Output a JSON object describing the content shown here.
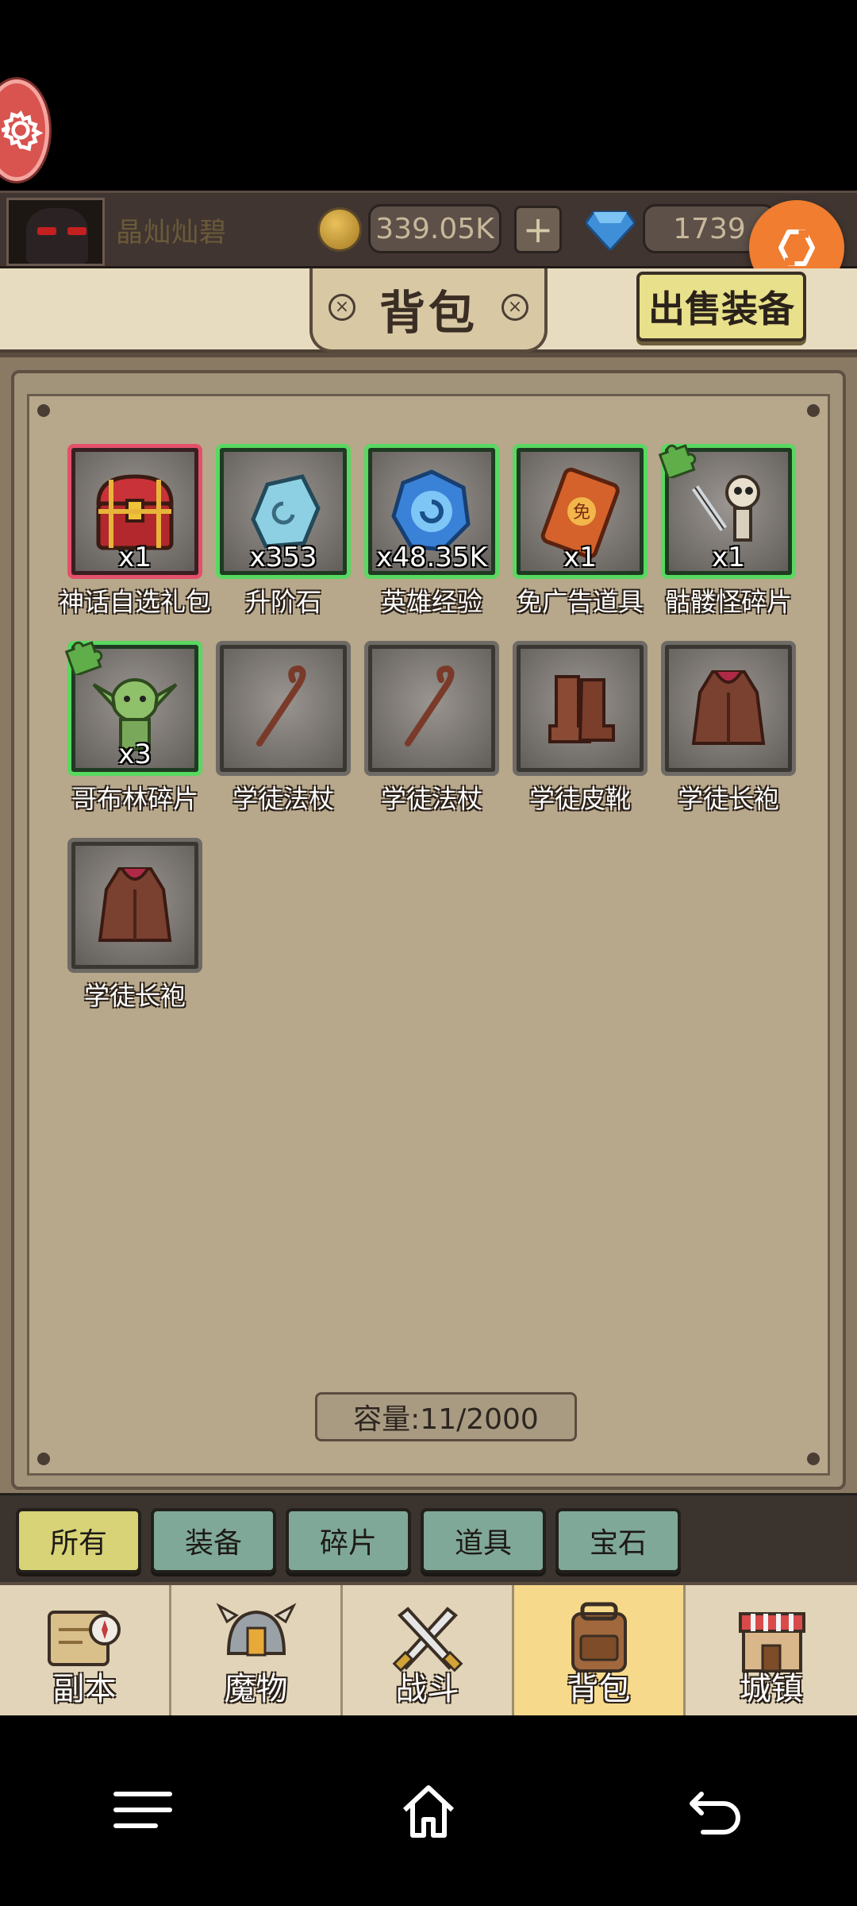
{
  "top_bar": {
    "player_name": "晶灿灿碧",
    "coins": "339.05K",
    "plus_label": "+",
    "gems": "1739"
  },
  "header": {
    "title": "背包",
    "sell_button": "出售装备",
    "left_bolt": "×",
    "right_bolt": "×"
  },
  "items": [
    {
      "label": "神话自选礼包",
      "qty": "x1",
      "rarity": "red",
      "icon": "treasure-chest-icon"
    },
    {
      "label": "升阶石",
      "qty": "x353",
      "rarity": "green",
      "icon": "upgrade-stone-icon"
    },
    {
      "label": "英雄经验",
      "qty": "x48.35K",
      "rarity": "green",
      "icon": "hero-exp-orb-icon"
    },
    {
      "label": "免广告道具",
      "qty": "x1",
      "rarity": "green",
      "icon": "ad-free-card-icon"
    },
    {
      "label": "骷髅怪碎片",
      "qty": "x1",
      "rarity": "green",
      "icon": "skeleton-shard-icon"
    },
    {
      "label": "哥布林碎片",
      "qty": "x3",
      "rarity": "green",
      "icon": "goblin-shard-icon"
    },
    {
      "label": "学徒法杖",
      "qty": "",
      "rarity": "gray",
      "icon": "staff-icon"
    },
    {
      "label": "学徒法杖",
      "qty": "",
      "rarity": "gray",
      "icon": "staff-icon"
    },
    {
      "label": "学徒皮靴",
      "qty": "",
      "rarity": "gray",
      "icon": "boots-icon"
    },
    {
      "label": "学徒长袍",
      "qty": "",
      "rarity": "gray",
      "icon": "robe-icon"
    },
    {
      "label": "学徒长袍",
      "qty": "",
      "rarity": "gray",
      "icon": "robe-icon"
    }
  ],
  "capacity": "容量:11/2000",
  "filter_tabs": [
    "所有",
    "装备",
    "碎片",
    "道具",
    "宝石"
  ],
  "active_filter": "所有",
  "nav": [
    {
      "label": "副本",
      "icon": "dungeon-map-icon"
    },
    {
      "label": "魔物",
      "icon": "monster-helmet-icon"
    },
    {
      "label": "战斗",
      "icon": "crossed-swords-icon"
    },
    {
      "label": "背包",
      "icon": "backpack-icon"
    },
    {
      "label": "城镇",
      "icon": "town-shop-icon"
    }
  ],
  "active_nav": "背包",
  "colors": {
    "rarity_red": "#e4506a",
    "rarity_green": "#58d860",
    "rarity_gray": "#6e6a66",
    "active_tab": "#d7d376",
    "tab": "#7fa899",
    "refresh_button": "#f07d30"
  }
}
